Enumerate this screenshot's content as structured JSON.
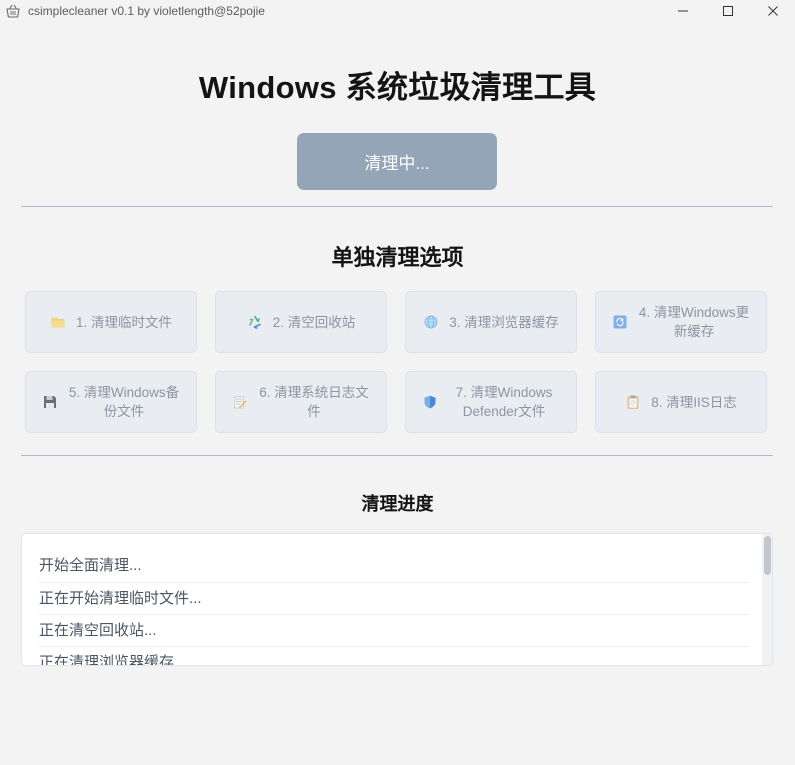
{
  "window": {
    "title": "csimplecleaner v0.1 by violetlength@52pojie",
    "app_icon": "basket-icon",
    "controls": {
      "minimize_icon": "minimize-icon",
      "maximize_icon": "maximize-icon",
      "close_icon": "close-icon"
    }
  },
  "header": {
    "title": "Windows 系统垃圾清理工具",
    "clean_all_label": "清理中..."
  },
  "options": {
    "title": "单独清理选项",
    "items": [
      {
        "label": "1. 清理临时文件",
        "icon": "folder-icon"
      },
      {
        "label": "2. 清空回收站",
        "icon": "recycle-icon"
      },
      {
        "label": "3. 清理浏览器缓存",
        "icon": "globe-icon"
      },
      {
        "label": "4. 清理Windows更新缓存",
        "icon": "update-icon"
      },
      {
        "label": "5. 清理Windows备份文件",
        "icon": "floppy-disk-icon"
      },
      {
        "label": "6. 清理系统日志文件",
        "icon": "memo-icon"
      },
      {
        "label": "7. 清理Windows Defender文件",
        "icon": "shield-icon"
      },
      {
        "label": "8. 清理IIS日志",
        "icon": "clipboard-icon"
      }
    ]
  },
  "progress": {
    "title": "清理进度",
    "log": [
      "开始全面清理...",
      "正在开始清理临时文件...",
      "正在清空回收站...",
      "正在清理浏览器缓存..."
    ]
  },
  "colors": {
    "clean_all_button": "#95a5b8",
    "card_background": "#e9ecf1",
    "card_text": "#8b95a3",
    "divider": "#b4b8cc"
  }
}
